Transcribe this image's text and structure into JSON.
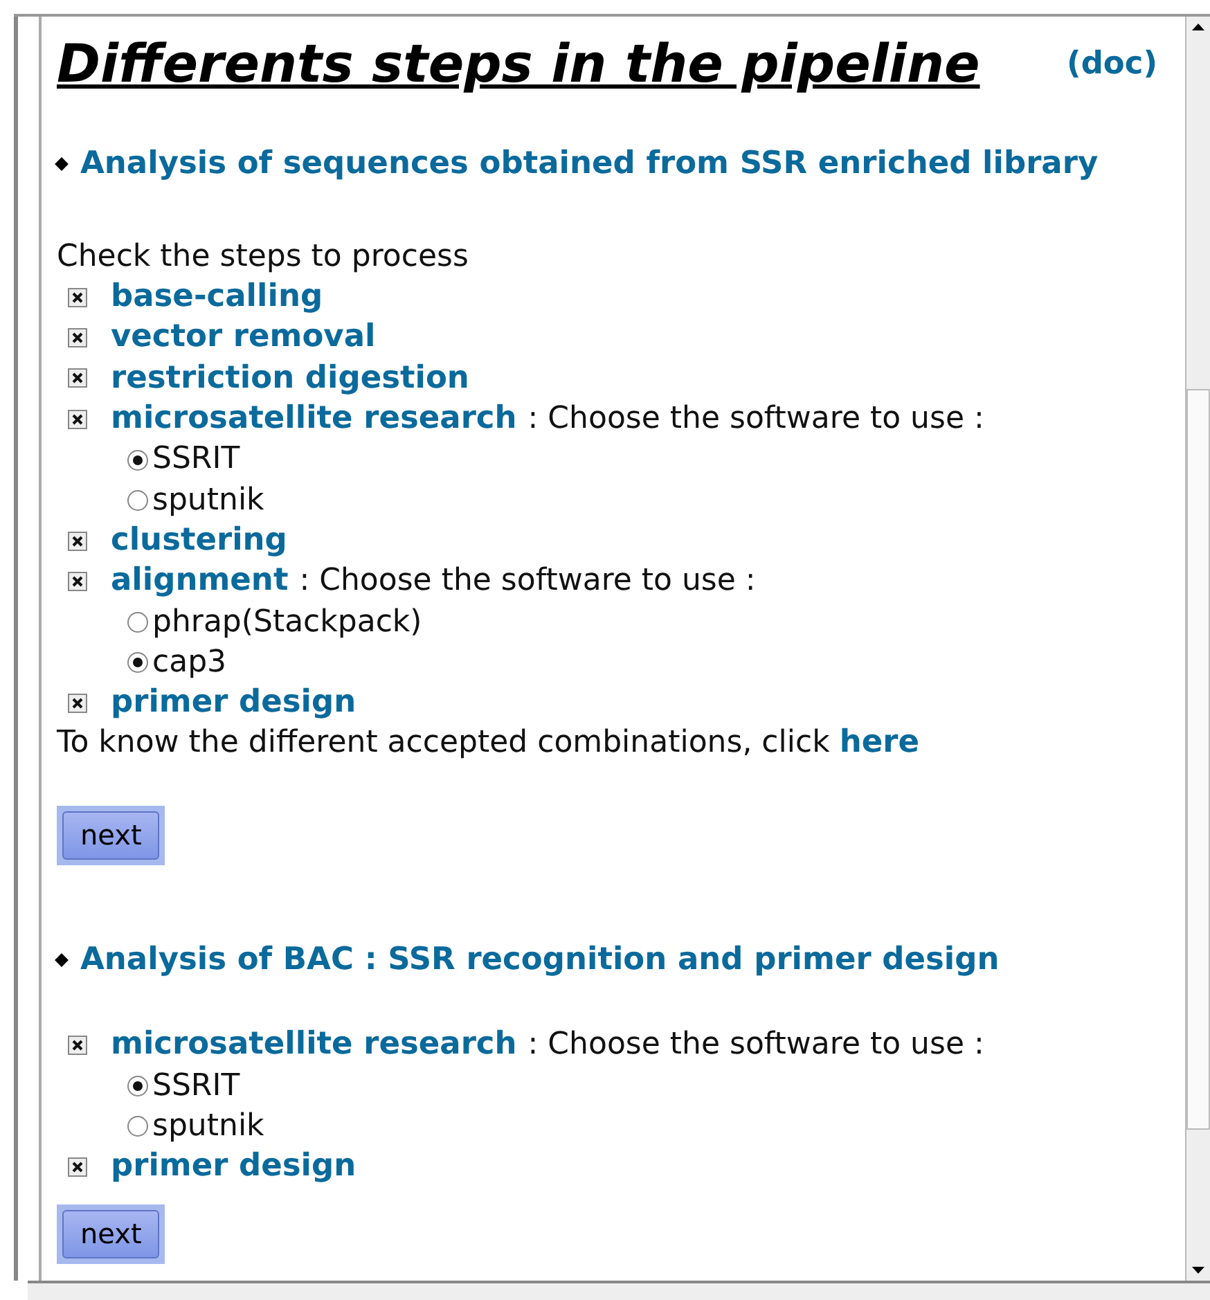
{
  "title": "Differents steps in the pipeline",
  "doc_link": "(doc)",
  "sections": [
    {
      "heading": "Analysis of sequences obtained from SSR enriched library",
      "intro": "Check the steps to process",
      "steps": [
        {
          "label": "base-calling",
          "checked": true
        },
        {
          "label": "vector removal",
          "checked": true
        },
        {
          "label": "restriction digestion",
          "checked": true
        },
        {
          "label": "microsatellite research",
          "checked": true,
          "note": ": Choose the software to use :",
          "options": [
            {
              "label": "SSRIT",
              "selected": true
            },
            {
              "label": "sputnik",
              "selected": false
            }
          ]
        },
        {
          "label": "clustering",
          "checked": true
        },
        {
          "label": "alignment",
          "checked": true,
          "note": ": Choose the software to use :",
          "options": [
            {
              "label": "phrap(Stackpack)",
              "selected": false
            },
            {
              "label": "cap3",
              "selected": true
            }
          ]
        },
        {
          "label": "primer design",
          "checked": true
        }
      ],
      "footer": {
        "text": "To know the different accepted combinations, click",
        "link": "here"
      },
      "button": "next"
    },
    {
      "heading": "Analysis of BAC : SSR recognition and primer design",
      "steps": [
        {
          "label": "microsatellite research",
          "checked": true,
          "note": ": Choose the software to use :",
          "options": [
            {
              "label": "SSRIT",
              "selected": true
            },
            {
              "label": "sputnik",
              "selected": false
            }
          ]
        },
        {
          "label": "primer design",
          "checked": true
        }
      ],
      "button": "next"
    }
  ]
}
